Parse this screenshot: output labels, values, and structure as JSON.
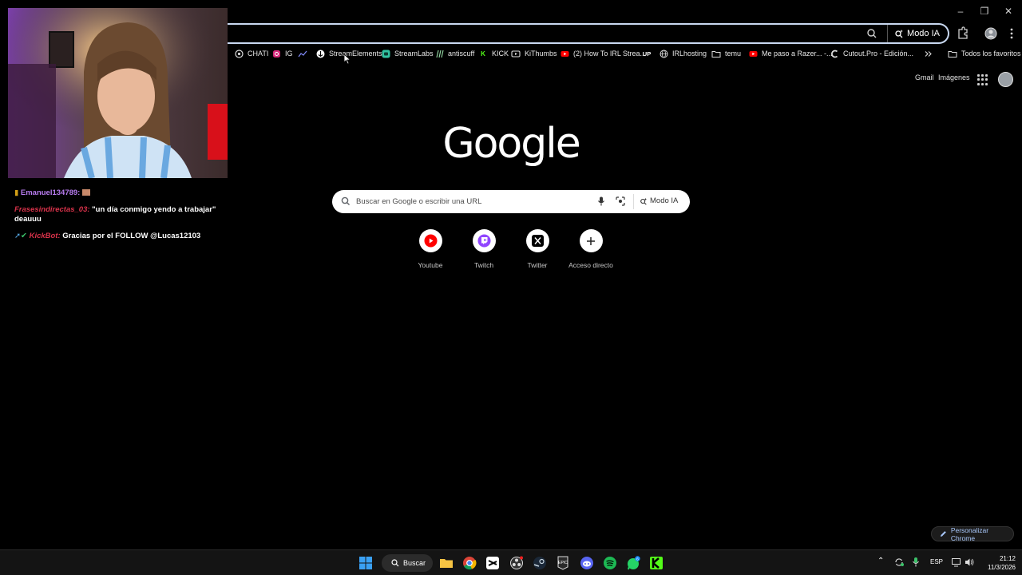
{
  "omnibox": {
    "modo_ia_label": "Modo IA"
  },
  "bookmarks": [
    {
      "label": "CHATI",
      "icon": "chatgpt-icon"
    },
    {
      "label": "IG",
      "icon": "instagram-icon"
    },
    {
      "label": "",
      "icon": "chart-icon"
    },
    {
      "label": "StreamElements",
      "icon": "streamelements-icon"
    },
    {
      "label": "StreamLabs",
      "icon": "streamlabs-icon"
    },
    {
      "label": "antiscuff",
      "icon": "antiscuff-icon"
    },
    {
      "label": "KICK",
      "icon": "kick-icon"
    },
    {
      "label": "KiThumbs",
      "icon": "kithumbs-icon"
    },
    {
      "label": "(2) How To IRL Strea...",
      "icon": "youtube-icon"
    },
    {
      "label": "",
      "icon": "up-icon",
      "badge": "UP"
    },
    {
      "label": "IRLhosting",
      "icon": "globe-icon"
    },
    {
      "label": "temu",
      "icon": "folder-icon"
    },
    {
      "label": "Me paso a Razer... -...",
      "icon": "youtube-icon"
    },
    {
      "label": "Cutout.Pro - Edición...",
      "icon": "cutout-icon"
    },
    {
      "label": "",
      "icon": "chevron-more-icon"
    },
    {
      "label": "Todos los favoritos",
      "icon": "folder-icon"
    }
  ],
  "chat": [
    {
      "user": "Emanuel134789:",
      "message": "",
      "color": "#b87cf0"
    },
    {
      "user": "Frasesindirectas_03:",
      "message": "\"un día conmigo yendo a trabajar\" deauuu",
      "color": "#d8324a"
    },
    {
      "user": "KickBot:",
      "message": "Gracias por el FOLLOW @Lucas12103",
      "color": "#d8324a"
    }
  ],
  "google": {
    "gmail": "Gmail",
    "images": "Imágenes",
    "logo": "Google",
    "search_placeholder": "Buscar en Google o escribir una URL",
    "modo_ia": "Modo IA",
    "shortcuts": [
      {
        "label": "Youtube"
      },
      {
        "label": "Twitch"
      },
      {
        "label": "Twitter"
      },
      {
        "label": "Acceso directo"
      }
    ],
    "customize": "Personalizar Chrome"
  },
  "taskbar": {
    "search_label": "Buscar",
    "language": "ESP",
    "time": "21:12",
    "date": "11/3/2026",
    "whatsapp_badge": "6"
  }
}
